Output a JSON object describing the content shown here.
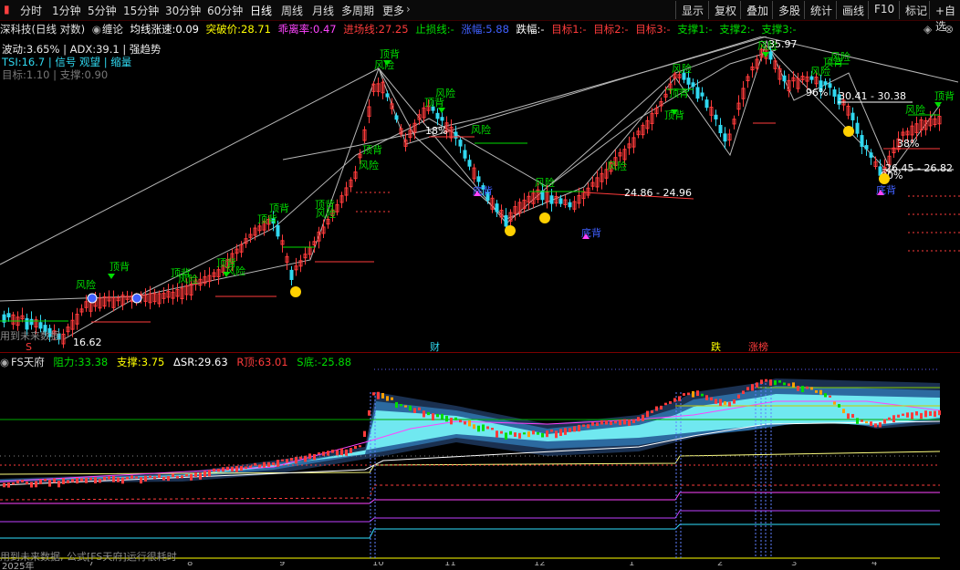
{
  "toolbar": {
    "periods": [
      "分时",
      "1分钟",
      "5分钟",
      "15分钟",
      "30分钟",
      "60分钟",
      "日线",
      "周线",
      "月线",
      "多周期",
      "更多"
    ],
    "active_period": "日线",
    "right_buttons": [
      "显示",
      "复权",
      "叠加",
      "多股",
      "统计",
      "画线",
      "F10",
      "标记",
      "+自选"
    ]
  },
  "info": {
    "stock_title": "深科技(日线 对数)",
    "chan_label": "缠论",
    "ma_speed_label": "均线涨速:",
    "ma_speed_value": "0.09",
    "breakout_label": "突破价:",
    "breakout_value": "28.71",
    "deviation_label": "乖离率:",
    "deviation_value": "0.47",
    "entry_label": "进场线:",
    "entry_value": "27.25",
    "stoploss_label": "止损线:",
    "stoploss_value": "-",
    "rise_label": "涨幅:",
    "rise_value": "5.88",
    "fall_label": "跌幅:",
    "fall_value": "-",
    "target1_label": "目标1:",
    "target1_value": "-",
    "target2_label": "目标2:",
    "target2_value": "-",
    "target3_label": "目标3:",
    "target3_value": "-",
    "support1_label": "支撑1:",
    "support1_value": "-",
    "support2_label": "支撑2:",
    "support2_value": "-",
    "support3_label": "支撑3:",
    "support3_value": "-"
  },
  "stats": {
    "volatility": "波动:3.65% | ADX:39.1 | 强趋势",
    "tsi": "TSI:16.7 | 信号 观望 | 缩量",
    "target_support": "目标:1.10 | 支撑:0.90"
  },
  "chart_marks": {
    "top_signal": "顶背",
    "risk": "风险",
    "bottom_signal": "底背",
    "fin_marker": "财",
    "fall_marker": "跌",
    "limit_marker": "涨榜",
    "s_marker": "S",
    "future_note": "用到未来数据",
    "high_price": "35.97",
    "low_price": "16.62",
    "range1": "24.86 - 24.96",
    "range2": "30.41 - 30.38",
    "range3": "26.45 - 26.82",
    "pct1": "18%",
    "pct2": "96%",
    "pct3": "38%",
    "pct4": "90%"
  },
  "indicator": {
    "name": "FS天府",
    "resistance_label": "阻力:",
    "resistance_value": "33.38",
    "support_label": "支撑:",
    "support_value": "3.75",
    "dsr_label": "ΔSR:",
    "dsr_value": "29.63",
    "rtop_label": "R顶:",
    "rtop_value": "63.01",
    "sbottom_label": "S底:",
    "sbottom_value": "-25.88"
  },
  "footer": {
    "note": "用到未来数据, 公式[FS天府]运行很耗时",
    "dates": [
      "2025年",
      "7",
      "8",
      "9",
      "10",
      "11",
      "12",
      "1",
      "2",
      "3",
      "4"
    ]
  },
  "colors": {
    "up": "#ff3b3b",
    "down": "#30d8f0",
    "green": "#00dd00",
    "yellow": "#ffff00",
    "magenta": "#ff44ff",
    "cyan": "#30e0ff"
  }
}
